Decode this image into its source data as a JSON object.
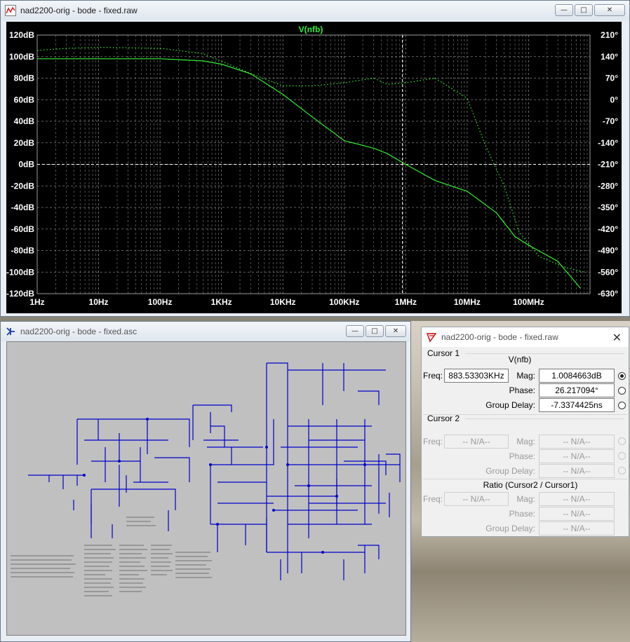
{
  "plot_window": {
    "title": "nad2200-orig - bode - fixed.raw",
    "buttons": {
      "minimize": "—",
      "maximize": "□",
      "close": "✕"
    }
  },
  "schematic_window": {
    "title": "nad2200-orig - bode - fixed.asc",
    "buttons": {
      "minimize": "—",
      "maximize": "□",
      "close": "✕"
    }
  },
  "cursor_window": {
    "title": "nad2200-orig - bode - fixed.raw",
    "close": "✕",
    "cursor1": {
      "heading": "Cursor 1",
      "trace": "V(nfb)",
      "freq_label": "Freq:",
      "freq_value": "883.53303KHz",
      "mag_label": "Mag:",
      "mag_value": "1.0084663dB",
      "phase_label": "Phase:",
      "phase_value": "26.217094°",
      "gd_label": "Group Delay:",
      "gd_value": "-7.3374425ns"
    },
    "cursor2": {
      "heading": "Cursor 2",
      "freq_label": "Freq:",
      "freq_value": "-- N/A--",
      "mag_label": "Mag:",
      "mag_value": "-- N/A--",
      "phase_label": "Phase:",
      "phase_value": "-- N/A--",
      "gd_label": "Group Delay:",
      "gd_value": "-- N/A--"
    },
    "ratio": {
      "heading": "Ratio (Cursor2 / Cursor1)",
      "freq_label": "Freq:",
      "freq_value": "-- N/A--",
      "mag_label": "Mag:",
      "mag_value": "-- N/A--",
      "phase_label": "Phase:",
      "phase_value": "-- N/A--",
      "gd_label": "Group Delay:",
      "gd_value": "-- N/A--"
    }
  },
  "colors": {
    "trace": "#33ee33",
    "axis_text": "#ffffff",
    "grid": "#808080",
    "wire": "#0000cc",
    "plot_bg": "#000000"
  },
  "chart_data": {
    "type": "line",
    "title": "V(nfb)",
    "x_scale": "log",
    "x_ticks": [
      "1Hz",
      "10Hz",
      "100Hz",
      "1KHz",
      "10KHz",
      "100KHz",
      "1MHz",
      "10MHz",
      "100MHz"
    ],
    "xlim": [
      1,
      1000000000
    ],
    "y_ticks_left": [
      "120dB",
      "100dB",
      "80dB",
      "60dB",
      "40dB",
      "20dB",
      "0dB",
      "-20dB",
      "-40dB",
      "-60dB",
      "-80dB",
      "-100dB",
      "-120dB"
    ],
    "y_ticks_right": [
      "210°",
      "140°",
      "70°",
      "0°",
      "-70°",
      "-140°",
      "-210°",
      "-280°",
      "-350°",
      "-420°",
      "-490°",
      "-560°",
      "-630°"
    ],
    "ylim_db": [
      -120,
      120
    ],
    "ylim_deg": [
      -630,
      210
    ],
    "cursor_x": 883533,
    "series": [
      {
        "name": "V(nfb)",
        "style": "magnitude-solid",
        "axis": "left",
        "x": [
          1,
          10,
          100,
          500,
          1000,
          3000,
          10000,
          30000,
          100000,
          300000,
          500000,
          1000000,
          3000000,
          10000000,
          30000000,
          60000000,
          100000000,
          300000000,
          700000000
        ],
        "y": [
          98,
          98,
          98,
          96,
          93,
          84,
          65,
          44,
          22,
          15,
          10,
          0,
          -15,
          -25,
          -45,
          -67,
          -75,
          -90,
          -115
        ]
      },
      {
        "name": "V(nfb)",
        "style": "phase-dotted",
        "axis": "right",
        "x": [
          1,
          3,
          10,
          100,
          500,
          1000,
          3000,
          10000,
          30000,
          100000,
          300000,
          500000,
          1000000,
          3000000,
          10000000,
          20000000,
          40000000,
          70000000,
          150000000,
          400000000,
          800000000
        ],
        "y": [
          160,
          167,
          170,
          167,
          150,
          125,
          85,
          45,
          45,
          55,
          70,
          50,
          55,
          70,
          5,
          -150,
          -280,
          -430,
          -510,
          -545,
          -560
        ]
      }
    ]
  }
}
